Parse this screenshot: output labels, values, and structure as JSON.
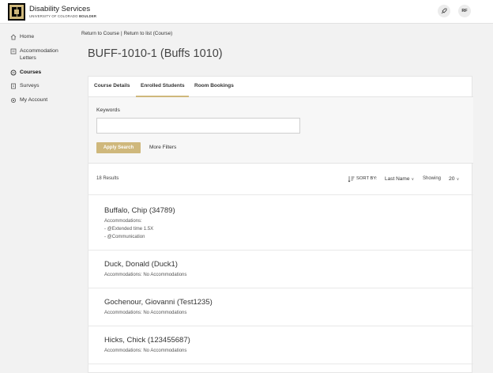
{
  "header": {
    "brand_name": "Disability Services",
    "brand_sub_prefix": "UNIVERSITY OF COLORADO ",
    "brand_sub_bold": "BOULDER",
    "avatar_initials": "RF",
    "icons": {
      "logo": "cu-logo-icon",
      "upgrade": "rocket-icon"
    }
  },
  "sidebar": {
    "items": [
      {
        "label": "Home",
        "icon": "home-icon",
        "active": false
      },
      {
        "label": "Accommodation Letters",
        "icon": "letter-icon",
        "active": false
      },
      {
        "label": "Courses",
        "icon": "courses-icon",
        "active": true
      },
      {
        "label": "Surveys",
        "icon": "survey-icon",
        "active": false
      },
      {
        "label": "My Account",
        "icon": "gear-icon",
        "active": false
      }
    ]
  },
  "breadcrumb": {
    "link1": "Return to Course",
    "separator": "|",
    "link2": "Return to list (Course)"
  },
  "page": {
    "title": "BUFF-1010-1 (Buffs 1010)"
  },
  "tabs": [
    {
      "label": "Course Details"
    },
    {
      "label": "Enrolled Students"
    },
    {
      "label": "Room Bookings"
    }
  ],
  "filters": {
    "keywords_label": "Keywords",
    "keywords_value": "",
    "keywords_placeholder": "",
    "apply_label": "Apply Search",
    "more_label": "More Filters"
  },
  "results": {
    "count_text": "18 Results",
    "sort_label": "SORT BY:",
    "sort_value": "Last Name",
    "showing_label": "Showing",
    "showing_value": "20"
  },
  "students": [
    {
      "name": "Buffalo, Chip (34789)",
      "line1": "Accommodations:",
      "line2": "- @Extended time 1.5X",
      "line3": "- @Communication"
    },
    {
      "name": "Duck, Donald (Duck1)",
      "line1": "Accommodations: No Accommodations"
    },
    {
      "name": "Gochenour, Giovanni (Test1235)",
      "line1": "Accommodations: No Accommodations"
    },
    {
      "name": "Hicks, Chick (123455687)",
      "line1": "Accommodations: No Accommodations"
    }
  ],
  "colors": {
    "accent": "#cfb87c",
    "background": "#f2f2f2"
  }
}
